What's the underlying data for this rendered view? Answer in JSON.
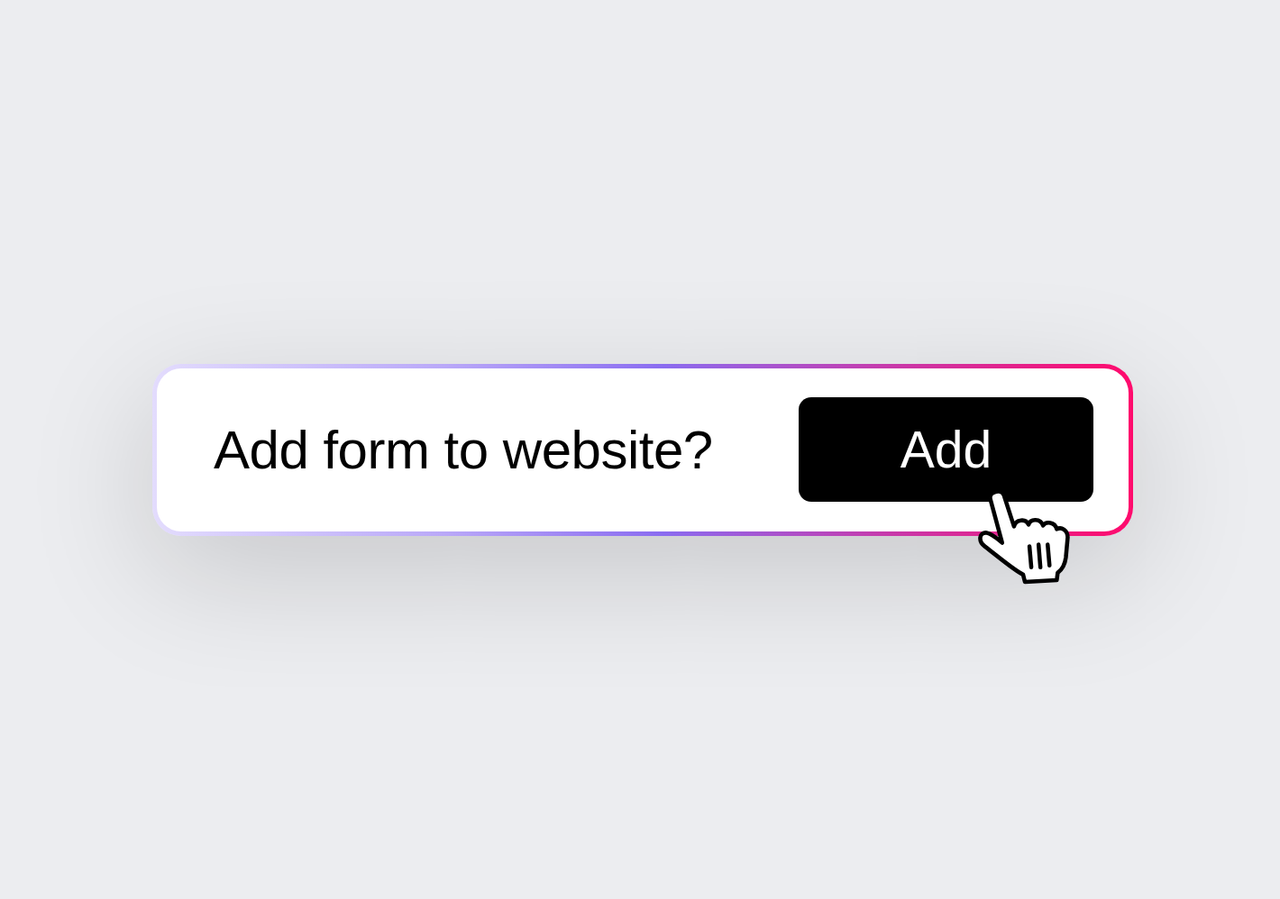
{
  "prompt_card": {
    "question": "Add form to website?",
    "action_button": {
      "label": "Add"
    }
  }
}
